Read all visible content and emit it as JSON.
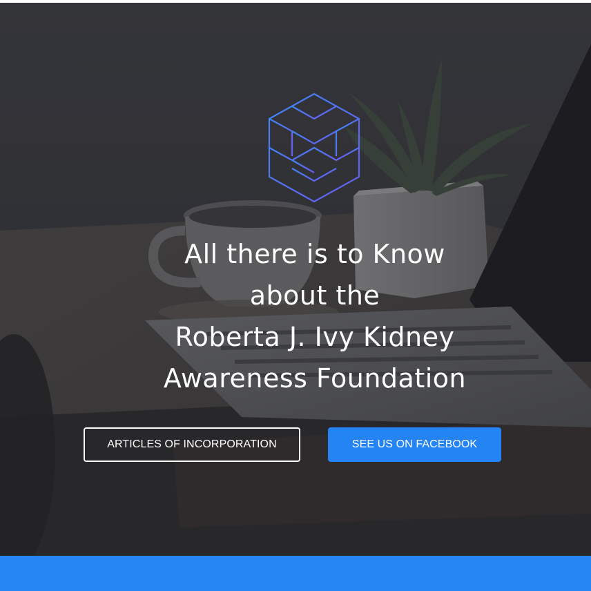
{
  "hero": {
    "headline_lines": [
      "All there is to Know",
      "about the",
      "Roberta J. Ivy Kidney",
      "Awareness Foundation"
    ],
    "logo_icon": "stacked-cubes-hexagon-icon",
    "background_image": "desk-laptop-coffee-cup-succulent-photo"
  },
  "buttons": {
    "articles_label": "ARTICLES OF INCORPORATION",
    "facebook_label": "SEE US ON FACEBOOK"
  },
  "colors": {
    "accent": "#2584f3",
    "logo_stroke_start": "#3f86f2",
    "logo_stroke_end": "#6a5cf0",
    "text": "#ffffff"
  }
}
